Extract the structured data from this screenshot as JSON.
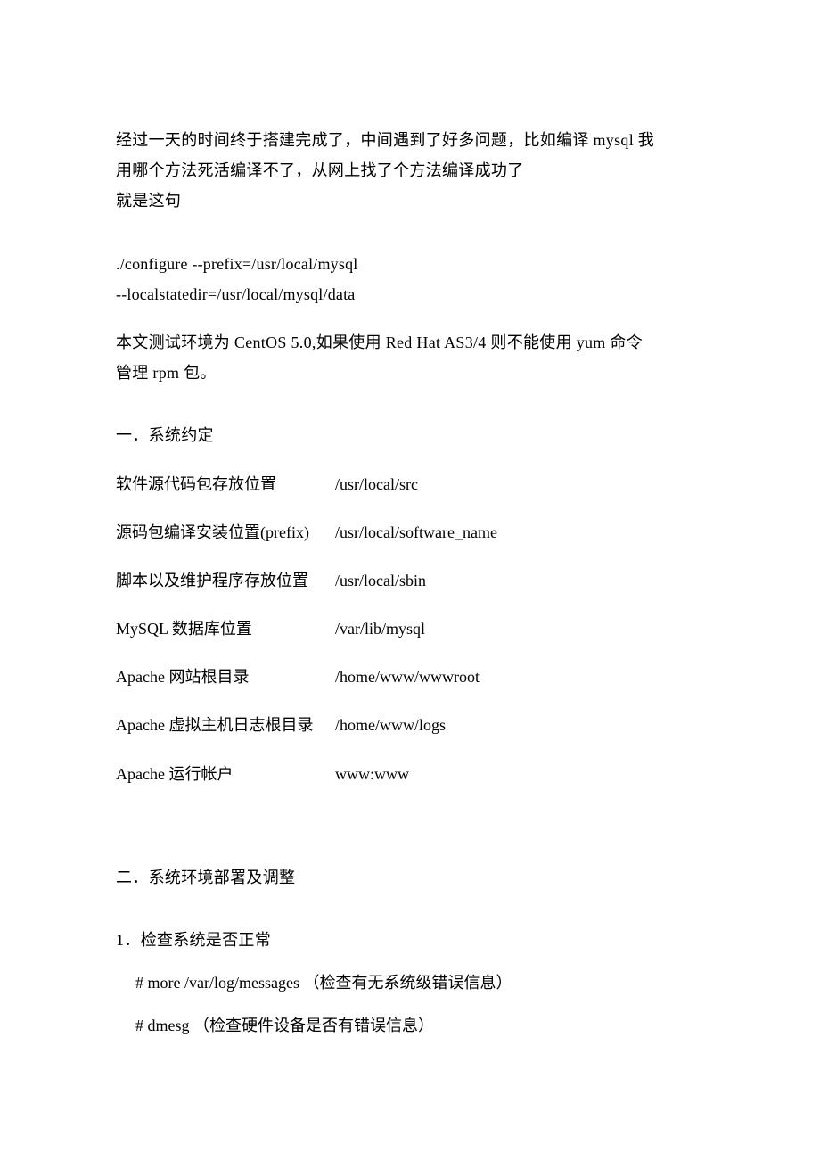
{
  "intro": {
    "line1": "经过一天的时间终于搭建完成了，中间遇到了好多问题，比如编译 mysql 我",
    "line2": "用哪个方法死活编译不了，从网上找了个方法编译成功了",
    "line3": "就是这句"
  },
  "code": {
    "line1": "./configure --prefix=/usr/local/mysql",
    "line2": "--localstatedir=/usr/local/mysql/data"
  },
  "env_note": {
    "line1": "本文测试环境为 CentOS 5.0,如果使用 Red Hat AS3/4 则不能使用 yum 命令",
    "line2": "管理 rpm 包。"
  },
  "section1": {
    "title": "一．系统约定",
    "rows": [
      {
        "label": "软件源代码包存放位置",
        "value": "/usr/local/src"
      },
      {
        "label": "源码包编译安装位置(prefix)",
        "value": "/usr/local/software_name"
      },
      {
        "label": "脚本以及维护程序存放位置",
        "value": "/usr/local/sbin"
      },
      {
        "label": "MySQL 数据库位置",
        "value": "/var/lib/mysql"
      },
      {
        "label": "Apache 网站根目录",
        "value": "/home/www/wwwroot"
      },
      {
        "label": "Apache 虚拟主机日志根目录",
        "value": "/home/www/logs"
      },
      {
        "label": "Apache 运行帐户",
        "value": "www:www"
      }
    ]
  },
  "section2": {
    "title": "二．系统环境部署及调整",
    "subtitle": "1．检查系统是否正常",
    "commands": [
      {
        "cmd": "# more /var/log/messages       （检查有无系统级错误信息）"
      },
      {
        "cmd": "# dmesg  （检查硬件设备是否有错误信息）"
      }
    ]
  }
}
